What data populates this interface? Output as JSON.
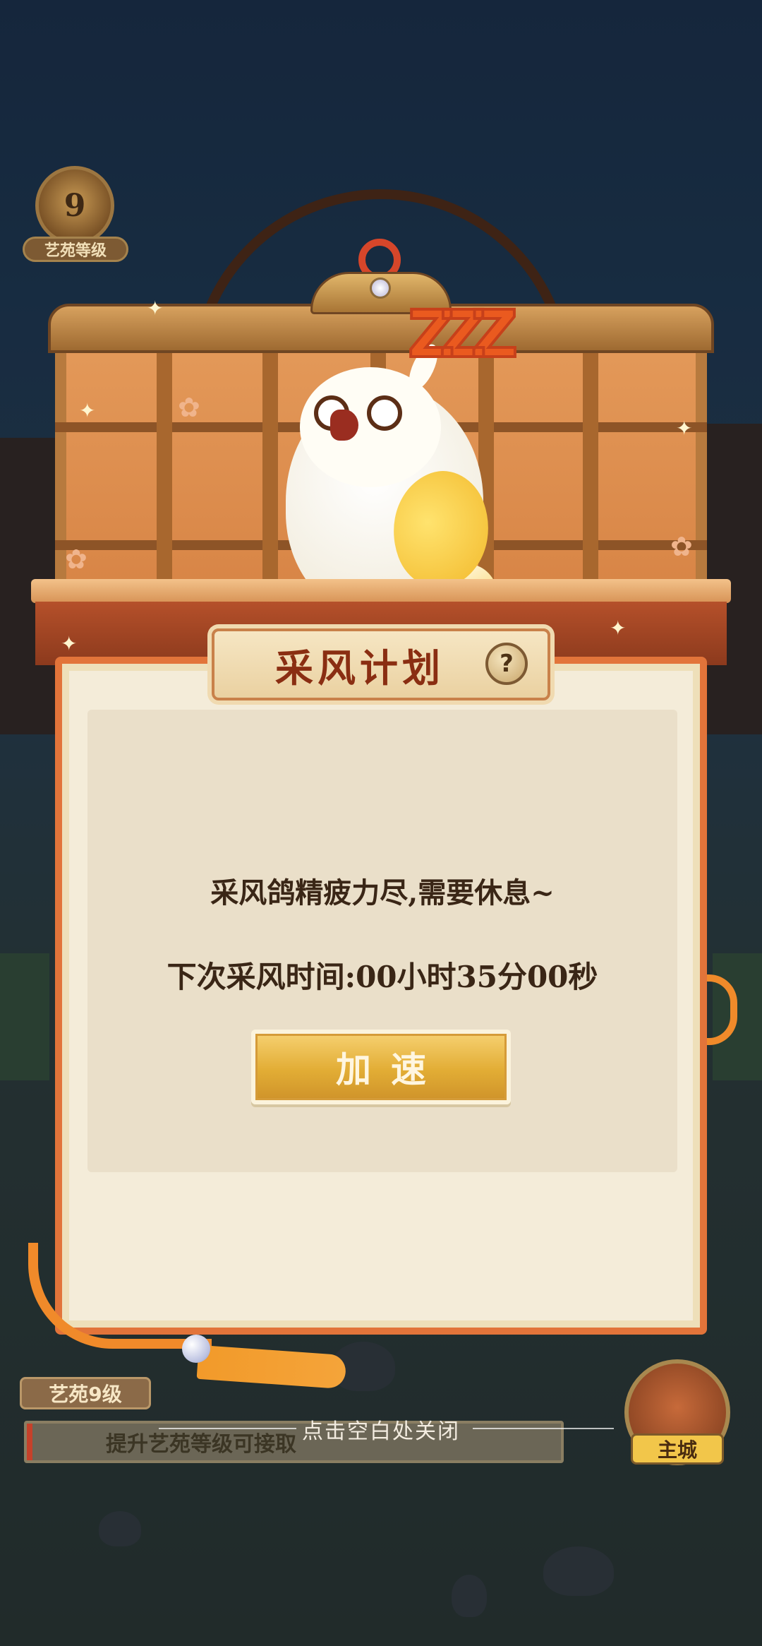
{
  "hud": {
    "level_number": "9",
    "level_label": "艺苑等级",
    "bottom_level": "艺苑9级",
    "progress_text": "提升艺苑等级可接取",
    "city_label": "主城",
    "close_hint": "点击空白处关闭"
  },
  "dialog": {
    "title": "采风计划",
    "help_icon": "?",
    "message": "采风鸽精疲力尽,需要休息~",
    "next_time": "下次采风时间:00小时35分00秒",
    "speed_button": "加速"
  },
  "decor": {
    "sleep_text": "ZZZ"
  },
  "colors": {
    "dialog_border": "#e2743a",
    "title_text": "#8a2e12",
    "button_gold": "#e2ad35"
  }
}
